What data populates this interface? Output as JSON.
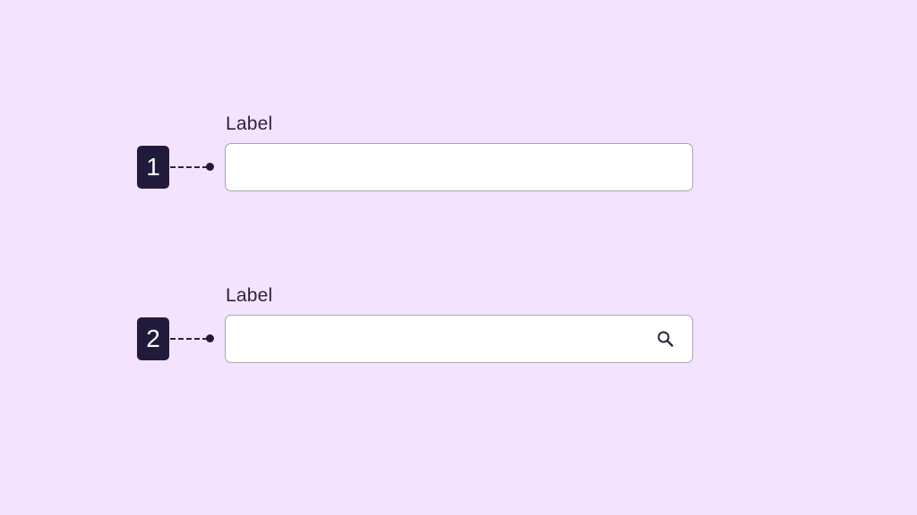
{
  "fields": [
    {
      "marker": "1",
      "label": "Label",
      "value": "",
      "placeholder": ""
    },
    {
      "marker": "2",
      "label": "Label",
      "value": "",
      "placeholder": "",
      "trailing_icon": "search-icon"
    }
  ],
  "colors": {
    "background": "#f3e3ff",
    "badge": "#211b3b",
    "input_border": "#a9a6ad",
    "input_fill": "#ffffff"
  }
}
